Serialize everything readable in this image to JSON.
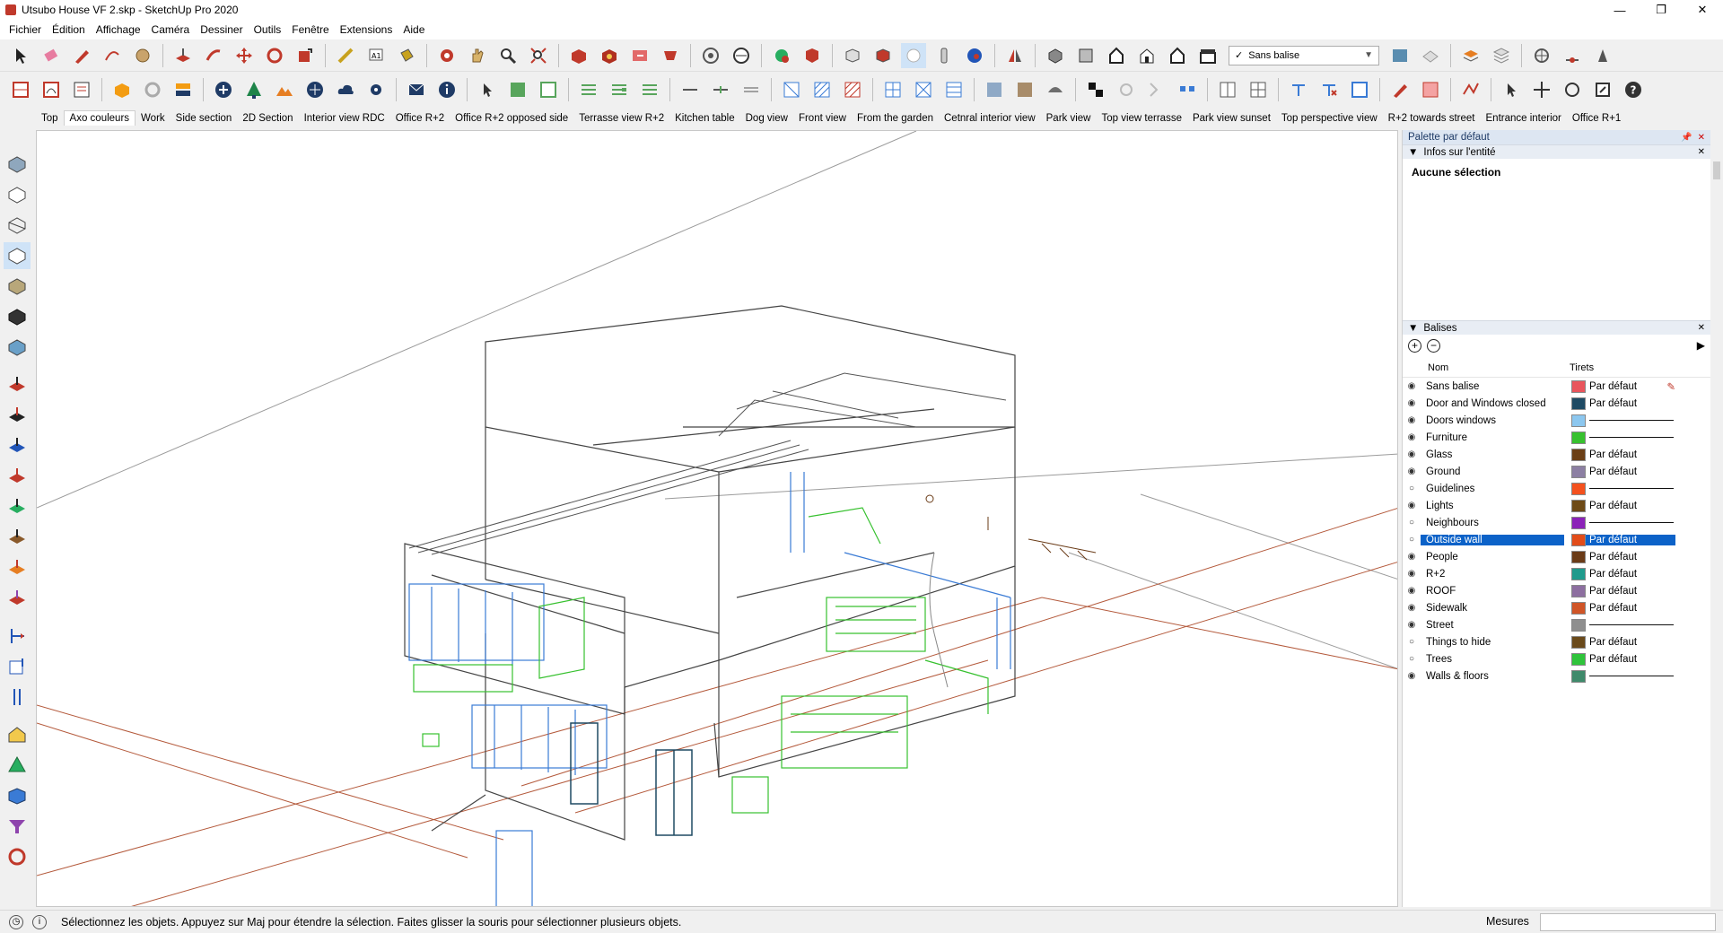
{
  "window": {
    "title": "Utsubo House VF 2.skp - SketchUp Pro 2020"
  },
  "menu": [
    "Fichier",
    "Édition",
    "Affichage",
    "Caméra",
    "Dessiner",
    "Outils",
    "Fenêtre",
    "Extensions",
    "Aide"
  ],
  "tag_selector": {
    "value": "Sans balise"
  },
  "scenes": [
    "Top",
    "Axo couleurs",
    "Work",
    "Side section",
    "2D Section",
    "Interior view RDC",
    "Office R+2",
    "Office R+2 opposed side",
    "Terrasse view R+2",
    "Kitchen table",
    "Dog view",
    "Front view",
    "From the garden",
    "Cetnral interior view",
    "Park view",
    "Top view terrasse",
    "Park view sunset",
    "Top perspective view",
    "R+2 towards street",
    "Entrance interior",
    "Office R+1"
  ],
  "active_scene": "Axo couleurs",
  "panel": {
    "title": "Palette par défaut",
    "entity_info": {
      "title": "Infos sur l'entité",
      "empty_label": "Aucune sélection"
    },
    "tags": {
      "title": "Balises",
      "col_name": "Nom",
      "col_dash": "Tirets",
      "rows": [
        {
          "name": "Sans balise",
          "visible": true,
          "color": "#e9555c",
          "dash": "Par défaut",
          "edit": true
        },
        {
          "name": "Door and Windows closed",
          "visible": true,
          "color": "#1f4a63",
          "dash": "Par défaut"
        },
        {
          "name": "Doors windows",
          "visible": true,
          "color": "#8cc7ef",
          "dash": "line"
        },
        {
          "name": "Furniture",
          "visible": true,
          "color": "#37c12f",
          "dash": "line"
        },
        {
          "name": "Glass",
          "visible": true,
          "color": "#6b3f16",
          "dash": "Par défaut"
        },
        {
          "name": "Ground",
          "visible": true,
          "color": "#8c7fa3",
          "dash": "Par défaut"
        },
        {
          "name": "Guidelines",
          "visible": false,
          "color": "#f4511e",
          "dash": "line"
        },
        {
          "name": "Lights",
          "visible": true,
          "color": "#6e4a17",
          "dash": "Par défaut"
        },
        {
          "name": "Neighbours",
          "visible": false,
          "color": "#8b22b8",
          "dash": "line"
        },
        {
          "name": "Outside wall",
          "visible": false,
          "color": "#e24c19",
          "dash": "Par défaut",
          "selected": true
        },
        {
          "name": "People",
          "visible": true,
          "color": "#6a3b17",
          "dash": "Par défaut"
        },
        {
          "name": "R+2",
          "visible": true,
          "color": "#1f9a8c",
          "dash": "Par défaut"
        },
        {
          "name": "ROOF",
          "visible": true,
          "color": "#8d6fa0",
          "dash": "Par défaut"
        },
        {
          "name": "Sidewalk",
          "visible": true,
          "color": "#d05527",
          "dash": "Par défaut"
        },
        {
          "name": "Street",
          "visible": true,
          "color": "#8f8f8f",
          "dash": "line"
        },
        {
          "name": "Things to hide",
          "visible": false,
          "color": "#6a4a1b",
          "dash": "Par défaut"
        },
        {
          "name": "Trees",
          "visible": false,
          "color": "#2fc43b",
          "dash": "Par défaut"
        },
        {
          "name": "Walls & floors",
          "visible": true,
          "color": "#3f8a6b",
          "dash": "line"
        }
      ]
    }
  },
  "status": {
    "message": "Sélectionnez les objets. Appuyez sur Maj pour étendre la sélection. Faites glisser la souris pour sélectionner plusieurs objets.",
    "measures_label": "Mesures",
    "measures_value": ""
  }
}
